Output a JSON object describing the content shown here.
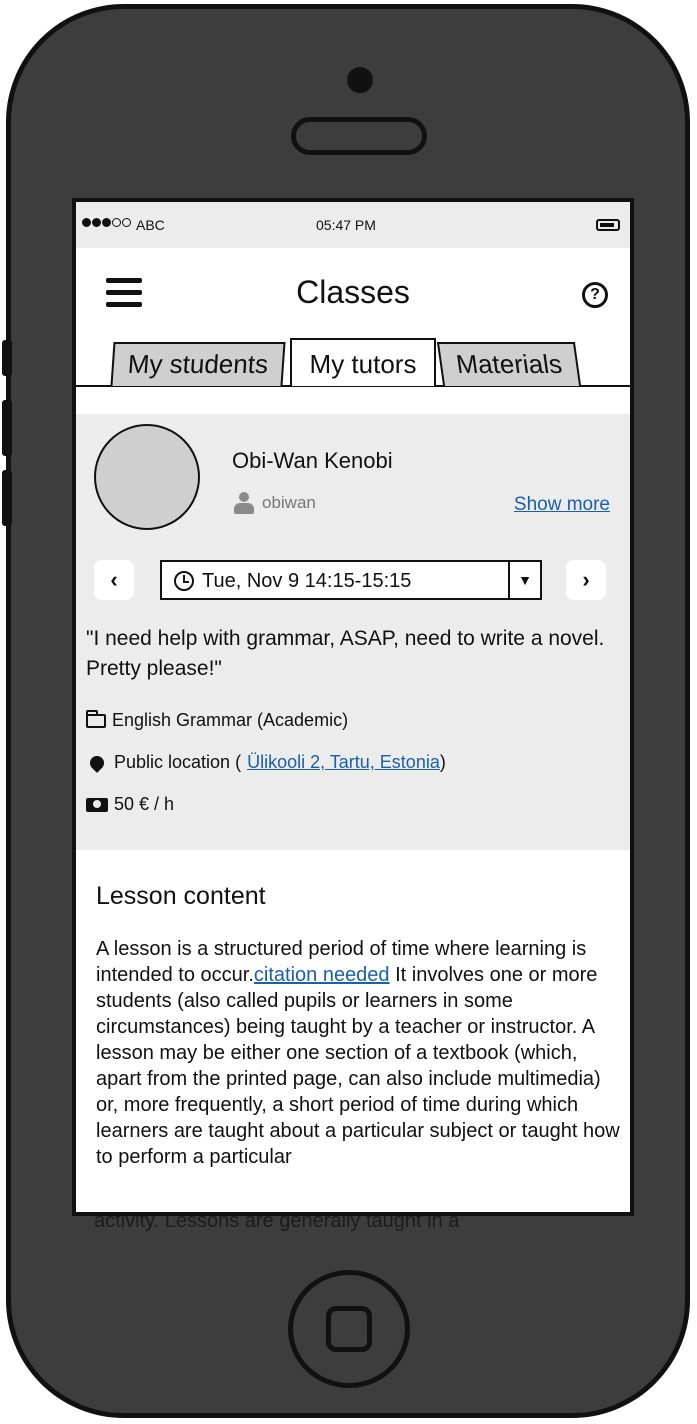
{
  "status_bar": {
    "carrier": "ABC",
    "time": "05:47 PM"
  },
  "header": {
    "title": "Classes"
  },
  "tabs": [
    {
      "label": "My students",
      "active": false
    },
    {
      "label": "My tutors",
      "active": true
    },
    {
      "label": "Materials",
      "active": false
    }
  ],
  "tutor": {
    "name": "Obi-Wan Kenobi",
    "username": "obiwan",
    "show_more_label": "Show more",
    "date_slot": "Tue, Nov 9 14:15-15:15",
    "request_text": "\"I need help with grammar, ASAP, need to write a novel. Pretty please!\"",
    "subject": "English Grammar (Academic)",
    "location_prefix": "Public location (",
    "location_link": "Ülikooli 2, Tartu, Estonia",
    "location_suffix": ")",
    "price": "50 € / h"
  },
  "lesson": {
    "title": "Lesson content",
    "text_before_link": "A lesson is a structured period of time where learning is intended to occur.",
    "link": "citation needed",
    "text_after_link": " It involves one or more students (also called pupils or learners in some circumstances) being taught by a teacher or instructor. A lesson may be either one section of a textbook (which, apart from the printed page, can also include multimedia) or, more frequently, a short period of time during which learners are taught about a particular subject or taught how to perform a particular",
    "overflow_line": "activity. Lessons are generally taught in a"
  },
  "colors": {
    "phone_body": "#3d3d3d",
    "card_background": "#ececec",
    "link": "#1b5fa8",
    "inactive_tab": "#cfcfcf"
  }
}
